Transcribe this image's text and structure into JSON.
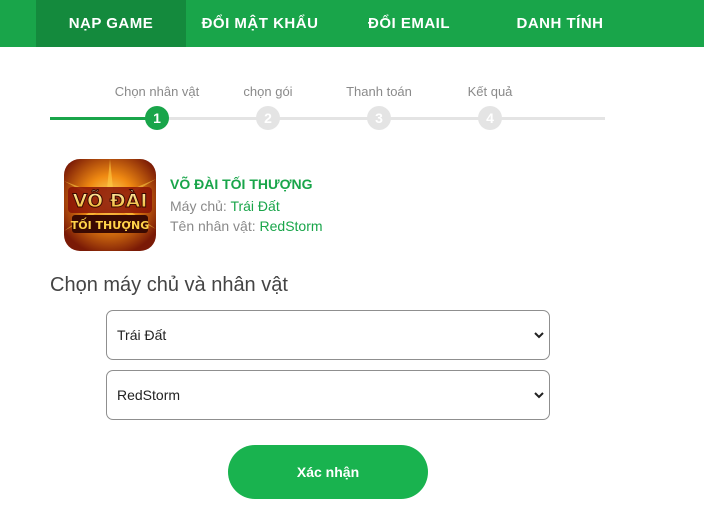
{
  "nav": {
    "tabs": [
      {
        "label": "NẠP GAME",
        "active": true
      },
      {
        "label": "ĐỔI MẬT KHẨU",
        "active": false
      },
      {
        "label": "ĐỔI EMAIL",
        "active": false
      },
      {
        "label": "DANH TÍNH",
        "active": false
      }
    ]
  },
  "stepper": {
    "current_step": 1,
    "steps": [
      {
        "label": "Chọn nhân vật",
        "number": "1"
      },
      {
        "label": "chọn gói",
        "number": "2"
      },
      {
        "label": "Thanh toán",
        "number": "3"
      },
      {
        "label": "Kết quả",
        "number": "4"
      }
    ]
  },
  "game": {
    "title": "VÕ ĐÀI TỐI THƯỢNG",
    "server_label": "Máy chủ:",
    "server_value": "Trái Đất",
    "character_label": "Tên nhân vật:",
    "character_value": "RedStorm"
  },
  "form": {
    "section_title": "Chọn máy chủ và nhân vật",
    "server_select": "Trái Đất",
    "character_select": "RedStorm",
    "confirm_label": "Xác nhận"
  },
  "colors": {
    "brand_green": "#19a54a",
    "active_tab": "#148a3d",
    "button_green": "#19b34f"
  }
}
